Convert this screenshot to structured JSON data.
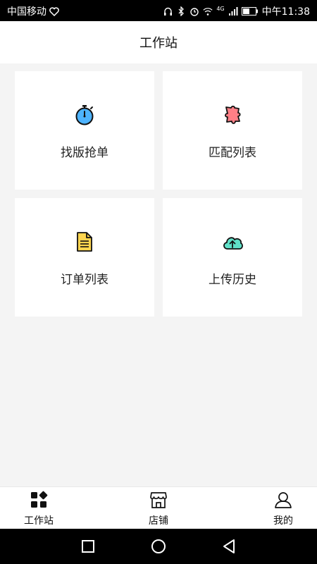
{
  "status_bar": {
    "carrier": "中国移动",
    "network": "4G",
    "time": "中午11:38"
  },
  "header": {
    "title": "工作站"
  },
  "cards": [
    {
      "label": "找版抢单",
      "icon": "stopwatch-icon"
    },
    {
      "label": "匹配列表",
      "icon": "puzzle-icon"
    },
    {
      "label": "订单列表",
      "icon": "document-icon"
    },
    {
      "label": "上传历史",
      "icon": "cloud-upload-icon"
    }
  ],
  "tabbar": {
    "items": [
      {
        "label": "工作站",
        "icon": "workstation-icon"
      },
      {
        "label": "店铺",
        "icon": "store-icon"
      },
      {
        "label": "我的",
        "icon": "user-icon"
      }
    ]
  },
  "colors": {
    "stopwatch": "#4db3ff",
    "puzzle": "#ff7f86",
    "document": "#ffd54f",
    "cloud": "#5fe0c8"
  }
}
